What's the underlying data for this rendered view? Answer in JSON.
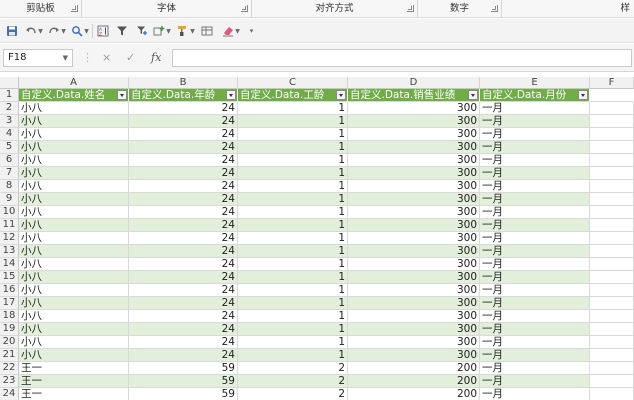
{
  "ribbon": {
    "groups": [
      "剪贴板",
      "字体",
      "对齐方式",
      "数字",
      "样"
    ]
  },
  "name_box": {
    "value": "F18"
  },
  "formula_bar": {
    "cancel_icon": "×",
    "confirm_icon": "✓",
    "fx_label": "fx",
    "value": ""
  },
  "columns": [
    "A",
    "B",
    "C",
    "D",
    "E",
    "F"
  ],
  "table": {
    "headers": [
      "自定义.Data.姓名",
      "自定义.Data.年龄",
      "自定义.Data.工龄",
      "自定义.Data.销售业绩",
      "自定义.Data.月份"
    ],
    "rows": [
      [
        "小八",
        "24",
        "1",
        "300",
        "一月"
      ],
      [
        "小八",
        "24",
        "1",
        "300",
        "一月"
      ],
      [
        "小八",
        "24",
        "1",
        "300",
        "一月"
      ],
      [
        "小八",
        "24",
        "1",
        "300",
        "一月"
      ],
      [
        "小八",
        "24",
        "1",
        "300",
        "一月"
      ],
      [
        "小八",
        "24",
        "1",
        "300",
        "一月"
      ],
      [
        "小八",
        "24",
        "1",
        "300",
        "一月"
      ],
      [
        "小八",
        "24",
        "1",
        "300",
        "一月"
      ],
      [
        "小八",
        "24",
        "1",
        "300",
        "一月"
      ],
      [
        "小八",
        "24",
        "1",
        "300",
        "一月"
      ],
      [
        "小八",
        "24",
        "1",
        "300",
        "一月"
      ],
      [
        "小八",
        "24",
        "1",
        "300",
        "一月"
      ],
      [
        "小八",
        "24",
        "1",
        "300",
        "一月"
      ],
      [
        "小八",
        "24",
        "1",
        "300",
        "一月"
      ],
      [
        "小八",
        "24",
        "1",
        "300",
        "一月"
      ],
      [
        "小八",
        "24",
        "1",
        "300",
        "一月"
      ],
      [
        "小八",
        "24",
        "1",
        "300",
        "一月"
      ],
      [
        "小八",
        "24",
        "1",
        "300",
        "一月"
      ],
      [
        "小八",
        "24",
        "1",
        "300",
        "一月"
      ],
      [
        "小八",
        "24",
        "1",
        "300",
        "一月"
      ],
      [
        "王一",
        "59",
        "2",
        "200",
        "一月"
      ],
      [
        "王一",
        "59",
        "2",
        "200",
        "一月"
      ],
      [
        "王一",
        "59",
        "2",
        "200",
        "一月"
      ]
    ]
  },
  "colors": {
    "header_fill": "#70ad47",
    "band_fill": "#e2efda"
  }
}
